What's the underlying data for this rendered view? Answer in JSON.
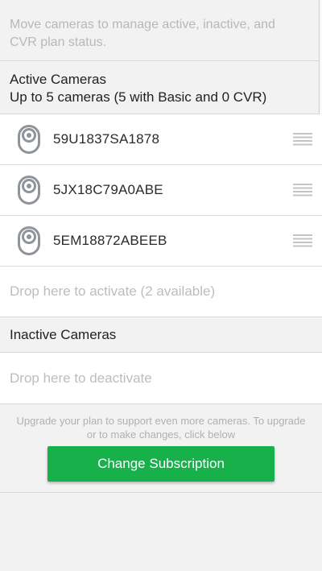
{
  "intro_text": "Move cameras to manage active, inactive, and CVR plan status.",
  "active_section": {
    "title": "Active Cameras",
    "subtitle": "Up to 5 cameras (5 with Basic and 0 CVR)"
  },
  "cameras": [
    {
      "name": "59U1837SA1878",
      "icon": "camera-icon"
    },
    {
      "name": "5JX18C79A0ABE",
      "icon": "camera-icon"
    },
    {
      "name": "5EM18872ABEEB",
      "icon": "camera-icon"
    }
  ],
  "drop_activate_text": "Drop here to activate (2 available)",
  "inactive_section": {
    "title": "Inactive Cameras"
  },
  "drop_deactivate_text": "Drop here to deactivate",
  "upgrade_note": "Upgrade your plan to support even more cameras. To upgrade or to make changes, click below",
  "change_button_label": "Change Subscription",
  "colors": {
    "accent": "#17b04b",
    "background": "#f2f2f2",
    "row_background": "#ffffff",
    "muted_text": "#bdbdbd",
    "camera_icon": "#8e9499"
  }
}
